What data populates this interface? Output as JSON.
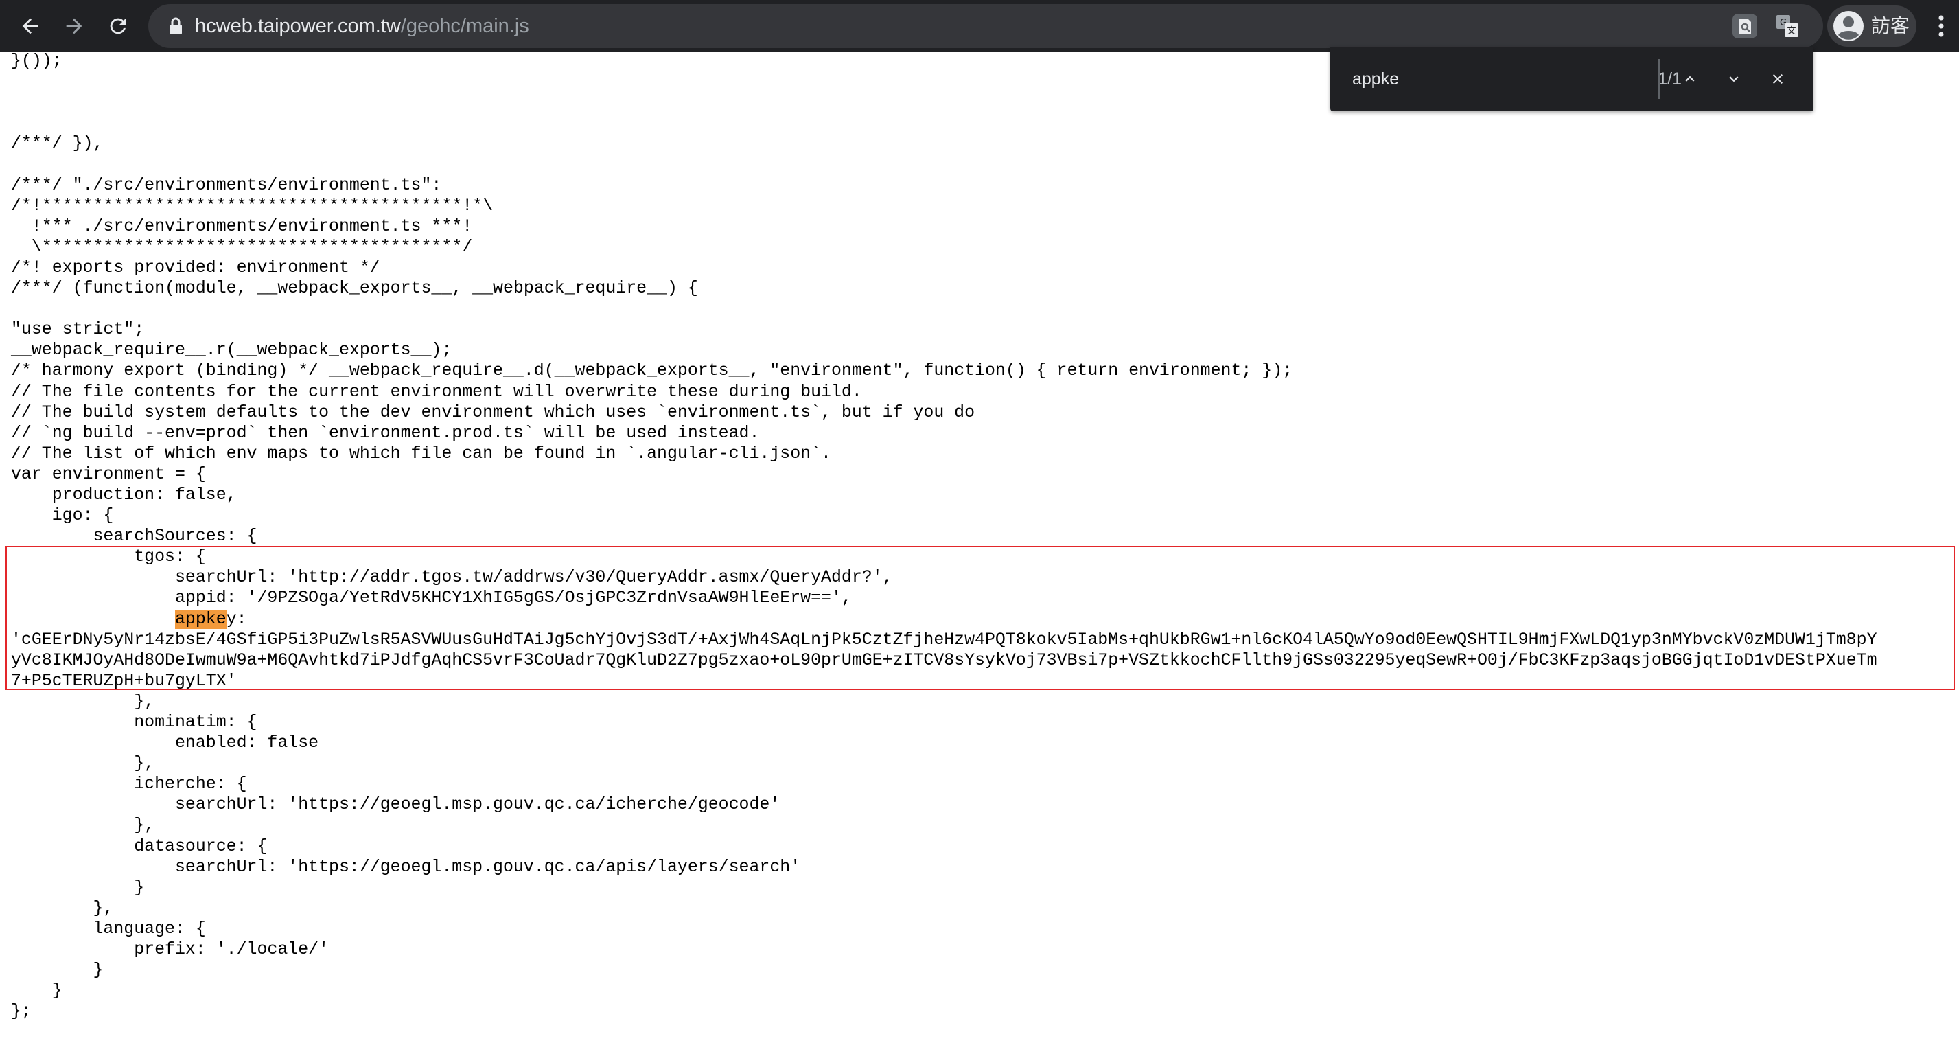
{
  "browser": {
    "url_host": "hcweb.taipower.com.tw",
    "url_path": "/geohc/main.js",
    "profile_name": "訪客",
    "icons": {
      "back": "arrow-left-icon",
      "forward": "arrow-right-icon",
      "reload": "reload-icon",
      "lock": "lock-icon",
      "find": "find-in-page-icon",
      "translate": "translate-icon",
      "avatar": "person-avatar-icon",
      "menu": "three-dots-menu-icon"
    },
    "colors": {
      "toolbar_bg": "#202124",
      "omnibox_bg": "#35363a",
      "highlight": "#f39a3c",
      "annotation_box": "#e3262a"
    }
  },
  "find_bar": {
    "query": "appke",
    "count": "1/1"
  },
  "code_lines": [
    "}());",
    "",
    "",
    "",
    "/***/ }),",
    "",
    "/***/ \"./src/environments/environment.ts\":",
    "/*!*****************************************!*\\",
    "  !*** ./src/environments/environment.ts ***!",
    "  \\*****************************************/",
    "/*! exports provided: environment */",
    "/***/ (function(module, __webpack_exports__, __webpack_require__) {",
    "",
    "\"use strict\";",
    "__webpack_require__.r(__webpack_exports__);",
    "/* harmony export (binding) */ __webpack_require__.d(__webpack_exports__, \"environment\", function() { return environment; });",
    "// The file contents for the current environment will overwrite these during build.",
    "// The build system defaults to the dev environment which uses `environment.ts`, but if you do",
    "// `ng build --env=prod` then `environment.prod.ts` will be used instead.",
    "// The list of which env maps to which file can be found in `.angular-cli.json`.",
    "var environment = {",
    "    production: false,",
    "    igo: {",
    "        searchSources: {",
    "            tgos: {",
    "                searchUrl: 'http://addr.tgos.tw/addrws/v30/QueryAddr.asmx/QueryAddr?',",
    "                appid: '/9PZSOga/YetRdV5KHCY1XhIG5gGS/OsjGPC3ZrdnVsaAW9HlEeErw==',",
    "",
    "'cGEErDNy5yNr14zbsE/4GSfiGP5i3PuZwlsR5ASVWUusGuHdTAiJg5chYjOvjS3dT/+AxjWh4SAqLnjPk5CztZfjheHzw4PQT8kokv5IabMs+qhUkbRGw1+nl6cKO4lA5QwYo9od0EewQSHTIL9HmjFXwLDQ1yp3nMYbvckV0zMDUW1jTm8pY",
    "yVc8IKMJOyAHd8ODeIwmuW9a+M6QAvhtkd7iPJdfgAqhCS5vrF3CoUadr7QgKluD2Z7pg5zxao+oL90prUmGE+zITCV8sYsykVoj73VBsi7p+VSZtkkochCFllth9jGSs032295yeqSewR+O0j/FbC3KFzp3aqsjoBGGjqtIoD1vDEStPXueTm",
    "7+P5cTERUZpH+bu7gyLTX'",
    "            },",
    "            nominatim: {",
    "                enabled: false",
    "            },",
    "            icherche: {",
    "                searchUrl: 'https://geoegl.msp.gouv.qc.ca/icherche/geocode'",
    "            },",
    "            datasource: {",
    "                searchUrl: 'https://geoegl.msp.gouv.qc.ca/apis/layers/search'",
    "            }",
    "        },",
    "        language: {",
    "            prefix: './locale/'",
    "        }",
    "    }",
    "};"
  ],
  "match_line": {
    "indent": "                ",
    "match": "appke",
    "rest": "y:"
  }
}
